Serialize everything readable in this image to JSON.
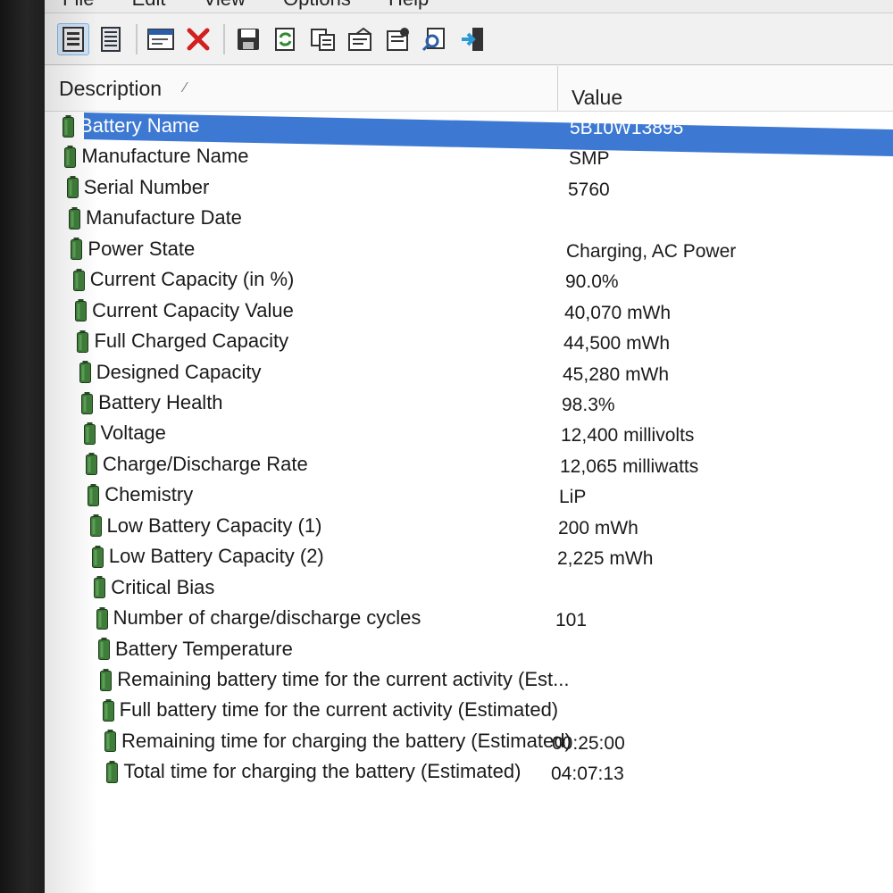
{
  "menu": [
    "File",
    "Edit",
    "View",
    "Options",
    "Help"
  ],
  "toolbar": {
    "buttons": [
      {
        "icon": "details-view-icon",
        "active": true
      },
      {
        "icon": "list-view-icon",
        "active": false
      },
      {
        "icon": "window-icon",
        "active": false
      },
      {
        "icon": "delete-icon",
        "active": false
      },
      {
        "icon": "save-icon",
        "active": false
      },
      {
        "icon": "refresh-icon",
        "active": false
      },
      {
        "icon": "copy-icon",
        "active": false
      },
      {
        "icon": "html-report-icon",
        "active": false
      },
      {
        "icon": "properties-icon",
        "active": false
      },
      {
        "icon": "find-icon",
        "active": false
      },
      {
        "icon": "exit-icon",
        "active": false
      }
    ]
  },
  "columns": {
    "description": "Description",
    "value": "Value"
  },
  "colors": {
    "selection": "#3d79d2",
    "battery_green": "#3f7d3a"
  },
  "rows": [
    {
      "label": "Battery Name",
      "value": "5B10W13895",
      "selected": true
    },
    {
      "label": "Manufacture Name",
      "value": "SMP"
    },
    {
      "label": "Serial Number",
      "value": "5760"
    },
    {
      "label": "Manufacture Date",
      "value": ""
    },
    {
      "label": "Power State",
      "value": "Charging, AC Power"
    },
    {
      "label": "Current Capacity (in %)",
      "value": "90.0%"
    },
    {
      "label": "Current Capacity Value",
      "value": "40,070 mWh"
    },
    {
      "label": "Full Charged Capacity",
      "value": "44,500 mWh"
    },
    {
      "label": "Designed Capacity",
      "value": "45,280 mWh"
    },
    {
      "label": "Battery Health",
      "value": "98.3%"
    },
    {
      "label": "Voltage",
      "value": "12,400 millivolts"
    },
    {
      "label": "Charge/Discharge Rate",
      "value": "12,065 milliwatts"
    },
    {
      "label": "Chemistry",
      "value": "LiP"
    },
    {
      "label": "Low Battery Capacity (1)",
      "value": "200 mWh"
    },
    {
      "label": "Low Battery Capacity (2)",
      "value": "2,225 mWh"
    },
    {
      "label": "Critical Bias",
      "value": ""
    },
    {
      "label": "Number of charge/discharge cycles",
      "value": "101"
    },
    {
      "label": "Battery Temperature",
      "value": ""
    },
    {
      "label": "Remaining battery time for the current activity (Est...",
      "value": ""
    },
    {
      "label": "Full battery time for the current activity (Estimated)",
      "value": ""
    },
    {
      "label": "Remaining time for charging the battery (Estimated)",
      "value": "00:25:00"
    },
    {
      "label": "Total  time for charging the battery (Estimated)",
      "value": "04:07:13"
    }
  ]
}
